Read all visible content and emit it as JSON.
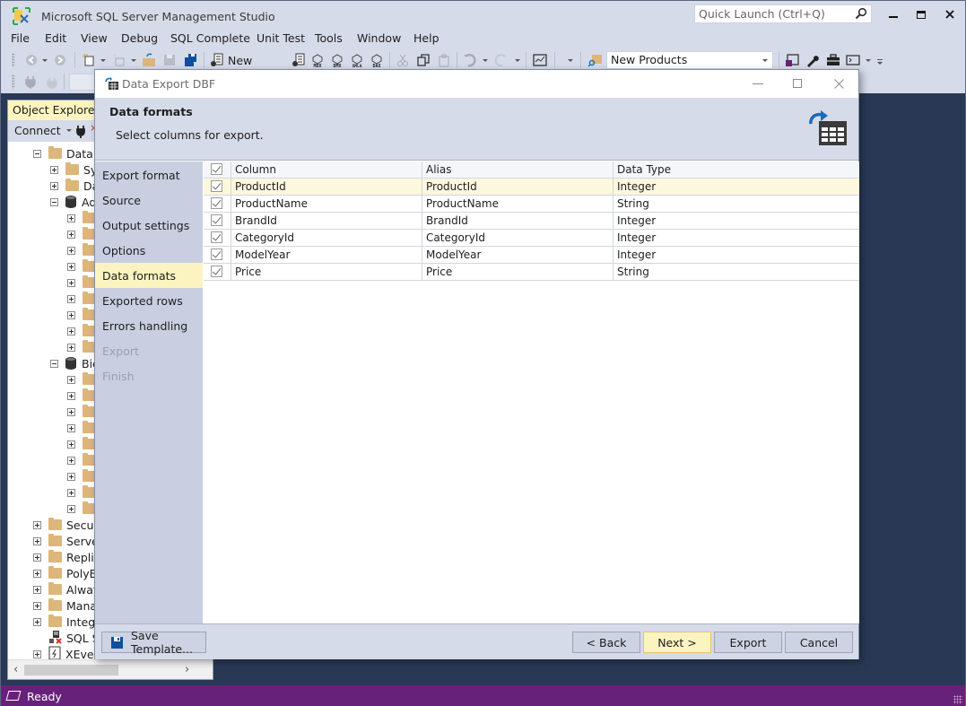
{
  "app": {
    "title": "Microsoft SQL Server Management Studio",
    "quick_launch_placeholder": "Quick Launch (Ctrl+Q)"
  },
  "menu": [
    "File",
    "Edit",
    "View",
    "Debug",
    "SQL Complete",
    "Unit Test",
    "Tools",
    "Window",
    "Help"
  ],
  "toolbar": {
    "new_query_label": "New Query",
    "analysis_buttons": [
      "MDX",
      "DMX",
      "XMLA",
      "DAX"
    ],
    "database_selected": "New Products"
  },
  "object_explorer": {
    "title": "Object Explorer",
    "connect_label": "Connect",
    "tree": [
      {
        "label": "Databa",
        "indent": 1,
        "expander": "minus",
        "icon": "folder"
      },
      {
        "label": "Sys",
        "indent": 2,
        "expander": "plus",
        "icon": "folder"
      },
      {
        "label": "Da",
        "indent": 2,
        "expander": "plus",
        "icon": "folder"
      },
      {
        "label": "Ad",
        "indent": 2,
        "expander": "minus",
        "icon": "database"
      },
      {
        "label": "",
        "indent": 3,
        "expander": "plus",
        "icon": "folder"
      },
      {
        "label": "",
        "indent": 3,
        "expander": "plus",
        "icon": "folder"
      },
      {
        "label": "",
        "indent": 3,
        "expander": "plus",
        "icon": "folder"
      },
      {
        "label": "",
        "indent": 3,
        "expander": "plus",
        "icon": "folder"
      },
      {
        "label": "",
        "indent": 3,
        "expander": "plus",
        "icon": "folder"
      },
      {
        "label": "",
        "indent": 3,
        "expander": "plus",
        "icon": "folder"
      },
      {
        "label": "",
        "indent": 3,
        "expander": "plus",
        "icon": "folder"
      },
      {
        "label": "",
        "indent": 3,
        "expander": "plus",
        "icon": "folder"
      },
      {
        "label": "",
        "indent": 3,
        "expander": "plus",
        "icon": "folder"
      },
      {
        "label": "Bic",
        "indent": 2,
        "expander": "minus",
        "icon": "database"
      },
      {
        "label": "",
        "indent": 3,
        "expander": "plus",
        "icon": "folder"
      },
      {
        "label": "",
        "indent": 3,
        "expander": "plus",
        "icon": "folder"
      },
      {
        "label": "",
        "indent": 3,
        "expander": "plus",
        "icon": "folder"
      },
      {
        "label": "",
        "indent": 3,
        "expander": "plus",
        "icon": "folder"
      },
      {
        "label": "",
        "indent": 3,
        "expander": "plus",
        "icon": "folder"
      },
      {
        "label": "",
        "indent": 3,
        "expander": "plus",
        "icon": "folder"
      },
      {
        "label": "",
        "indent": 3,
        "expander": "plus",
        "icon": "folder"
      },
      {
        "label": "",
        "indent": 3,
        "expander": "plus",
        "icon": "folder"
      },
      {
        "label": "",
        "indent": 3,
        "expander": "plus",
        "icon": "folder"
      },
      {
        "label": "Securi",
        "indent": 1,
        "expander": "plus",
        "icon": "folder"
      },
      {
        "label": "Server",
        "indent": 1,
        "expander": "plus",
        "icon": "folder"
      },
      {
        "label": "Replic",
        "indent": 1,
        "expander": "plus",
        "icon": "folder"
      },
      {
        "label": "PolyBa",
        "indent": 1,
        "expander": "plus",
        "icon": "folder"
      },
      {
        "label": "Alway",
        "indent": 1,
        "expander": "plus",
        "icon": "folder"
      },
      {
        "label": "Manag",
        "indent": 1,
        "expander": "plus",
        "icon": "folder"
      },
      {
        "label": "Integra",
        "indent": 1,
        "expander": "plus",
        "icon": "folder"
      },
      {
        "label": "SQL Se",
        "indent": 1,
        "expander": "none",
        "icon": "agent"
      },
      {
        "label": "XEven",
        "indent": 1,
        "expander": "plus",
        "icon": "xevent"
      }
    ]
  },
  "dialog": {
    "title": "Data Export DBF",
    "header_title": "Data formats",
    "header_subtitle": "Select columns for export.",
    "nav": [
      {
        "label": "Export format",
        "state": "normal"
      },
      {
        "label": "Source",
        "state": "normal"
      },
      {
        "label": "Output settings",
        "state": "normal"
      },
      {
        "label": "Options",
        "state": "normal"
      },
      {
        "label": "Data formats",
        "state": "active"
      },
      {
        "label": "Exported rows",
        "state": "normal"
      },
      {
        "label": "Errors handling",
        "state": "normal"
      },
      {
        "label": "Export",
        "state": "disabled"
      },
      {
        "label": "Finish",
        "state": "disabled"
      }
    ],
    "grid": {
      "header_checked": true,
      "columns": [
        "Column",
        "Alias",
        "Data Type"
      ],
      "rows": [
        {
          "checked": true,
          "column": "ProductId",
          "alias": "ProductId",
          "type": "Integer",
          "selected": true
        },
        {
          "checked": true,
          "column": "ProductName",
          "alias": "ProductName",
          "type": "String",
          "selected": false
        },
        {
          "checked": true,
          "column": "BrandId",
          "alias": "BrandId",
          "type": "Integer",
          "selected": false
        },
        {
          "checked": true,
          "column": "CategoryId",
          "alias": "CategoryId",
          "type": "Integer",
          "selected": false
        },
        {
          "checked": true,
          "column": "ModelYear",
          "alias": "ModelYear",
          "type": "Integer",
          "selected": false
        },
        {
          "checked": true,
          "column": "Price",
          "alias": "Price",
          "type": "String",
          "selected": false
        }
      ]
    },
    "buttons": {
      "save_template": "Save Template...",
      "back": "< Back",
      "next": "Next >",
      "export": "Export",
      "cancel": "Cancel"
    }
  },
  "status": {
    "text": "Ready"
  },
  "colors": {
    "accent_highlight": "#fcf4c0",
    "status_bar": "#68217a",
    "workspace": "#293955",
    "chrome": "#d6dbe9"
  }
}
